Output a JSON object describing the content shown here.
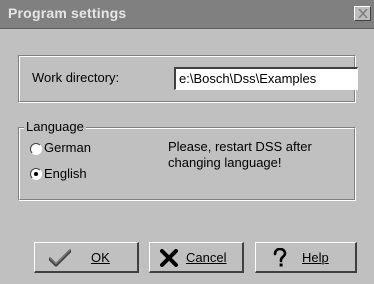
{
  "window": {
    "title": "Program settings"
  },
  "settings": {
    "work_directory_label": "Work directory:",
    "work_directory_value": "e:\\Bosch\\Dss\\Examples"
  },
  "language": {
    "group_label": "Language",
    "options": [
      {
        "label": "German",
        "selected": false
      },
      {
        "label": "English",
        "selected": true
      }
    ],
    "message": "Please, restart DSS after changing language!"
  },
  "buttons": {
    "ok": "OK",
    "cancel": "Cancel",
    "help": "Help"
  },
  "icons": {
    "close": "close-icon",
    "ok": "checkmark-icon",
    "cancel": "x-mark-icon",
    "help": "question-mark-icon"
  },
  "colors": {
    "titlebar": "#808080",
    "face": "#c0c0c0"
  }
}
